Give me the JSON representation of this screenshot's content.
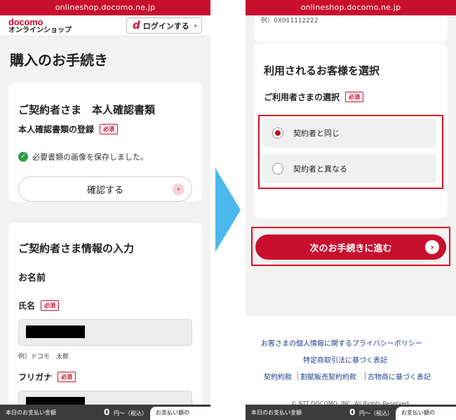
{
  "url": "onlineshop.docomo.ne.jp",
  "header": {
    "brand": "docomo",
    "brand_sub": "オンラインショップ",
    "login_d": "d",
    "login_label": "ログインする"
  },
  "page_title": "購入のお手続き",
  "id_card": {
    "heading": "ご契約者さま　本人確認書類",
    "field_label": "本人確認書類の登録",
    "required": "必須",
    "saved_message": "必要書類の画像を保存しました。",
    "confirm_button": "確認する"
  },
  "info_card": {
    "heading": "ご契約者さま情報の入力",
    "name_section": "お名前",
    "name_label": "氏名",
    "name_required": "必須",
    "name_hint": "例）ドコモ　太郎",
    "kana_label": "フリガナ",
    "kana_required": "必須"
  },
  "bottom_bar": {
    "label": "本日のお支払い金額",
    "amount": "0",
    "unit": "円〜（税込）",
    "button": "お支払い額の"
  },
  "right": {
    "prev_text": "例）0X011112222",
    "user_card": {
      "heading": "利用されるお客様を選択",
      "field_label": "ご利用者さまの選択",
      "required": "必須",
      "options": [
        {
          "label": "契約者と同じ",
          "selected": true
        },
        {
          "label": "契約者と異なる",
          "selected": false
        }
      ]
    },
    "next_button": "次のお手続きに進む",
    "footer": {
      "privacy": "お客さまの個人情報に関するプライバシーポリシー",
      "commerce": "特定商取引法に基づく表記",
      "contract": "契約約款",
      "installment": "割賦販売契約約款",
      "antique": "古物商に基づく表記",
      "copyright": "© NTT DOCOMO, INC. All Rights Reserved."
    }
  },
  "colors": {
    "brand_red": "#c8102e",
    "arrow_blue": "#4db8ee",
    "highlight_red": "#e0101f"
  }
}
